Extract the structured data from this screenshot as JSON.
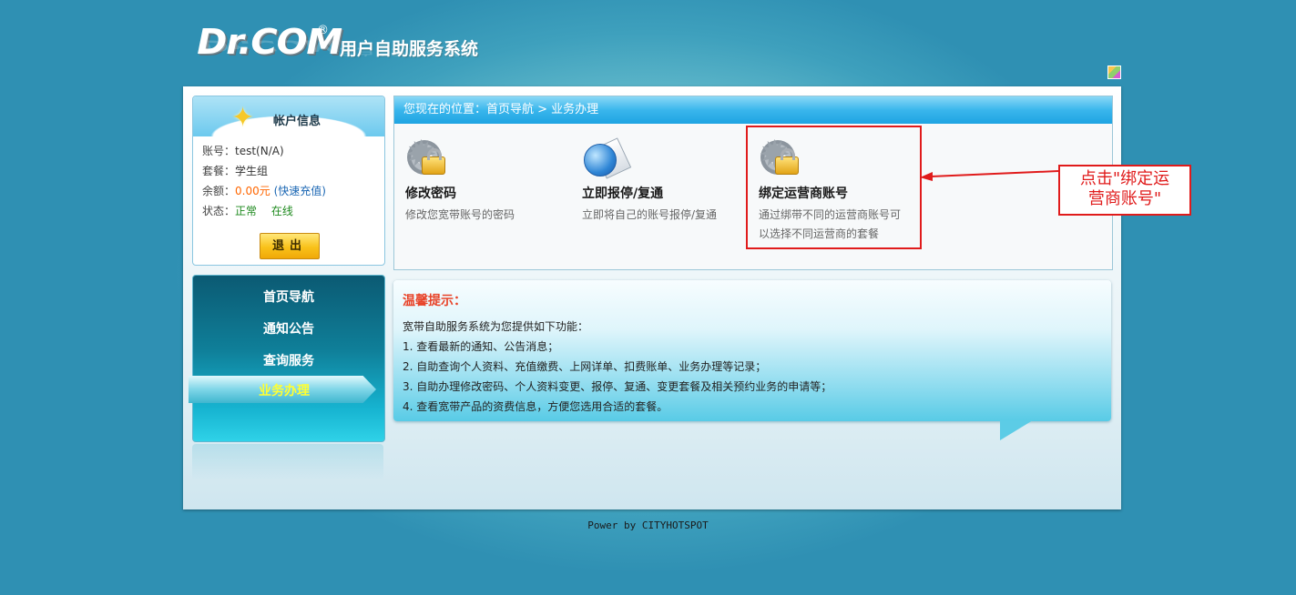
{
  "header": {
    "logo_text": "Dr.COM",
    "logo_mark": "®",
    "system_title": "用户自助服务系统"
  },
  "account": {
    "title": "帐户信息",
    "account_label": "账号：",
    "account_value": "test(N/A)",
    "plan_label": "套餐：",
    "plan_value": "学生组",
    "balance_label": "余额：",
    "balance_value": "0.00元",
    "recharge_link": "(快速充值)",
    "status_label": "状态：",
    "status_value": "正常",
    "online_value": "在线",
    "logout_label": "退出"
  },
  "nav": {
    "items": [
      {
        "label": "首页导航"
      },
      {
        "label": "通知公告"
      },
      {
        "label": "查询服务"
      },
      {
        "label": "业务办理"
      }
    ],
    "active_index": 3
  },
  "breadcrumb": {
    "text": "您现在的位置：首页导航 > 业务办理"
  },
  "services": [
    {
      "name": "修改密码",
      "desc1": "修改您宽带账号的密码",
      "desc2": "",
      "icon": "gear-lock-icon"
    },
    {
      "name": "立即报停/复通",
      "desc1": "立即将自己的账号报停/复通",
      "desc2": "",
      "icon": "globe-document-icon"
    },
    {
      "name": "绑定运营商账号",
      "desc1": "通过绑带不同的运营商账号可",
      "desc2": "以选择不同运营商的套餐",
      "icon": "gear-lock-icon"
    }
  ],
  "annotation": {
    "line1": "点击\"绑定运",
    "line2": "营商账号\"",
    "color": "#e01b1b"
  },
  "tips": {
    "title": "温馨提示：",
    "intro": "宽带自助服务系统为您提供如下功能：",
    "lines": [
      "1. 查看最新的通知、公告消息；",
      "2. 自助查询个人资料、充值缴费、上网详单、扣费账单、业务办理等记录；",
      "3. 自助办理修改密码、个人资料变更、报停、复通、变更套餐及相关预约业务的申请等；",
      "4. 查看宽带产品的资费信息，方便您选用合适的套餐。"
    ]
  },
  "footer": {
    "text": "Power by CITYHOTSPOT"
  }
}
